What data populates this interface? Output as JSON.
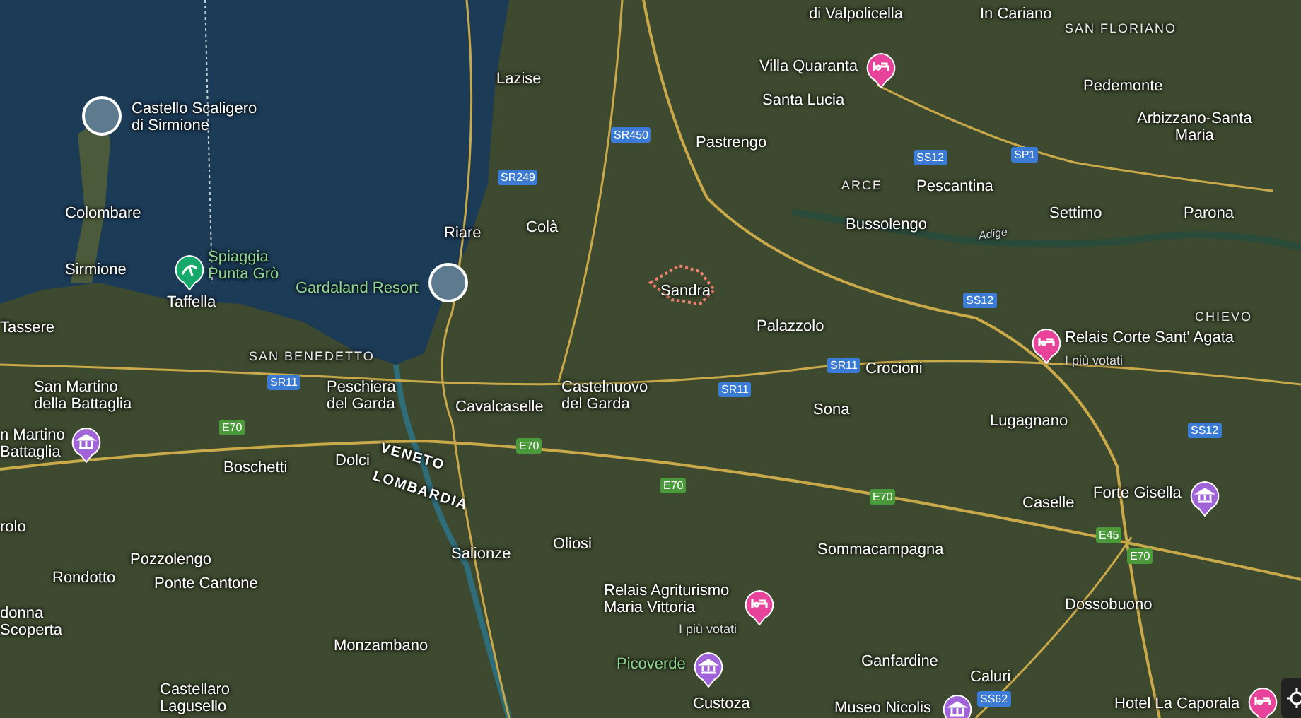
{
  "map": {
    "places": [
      {
        "name": "di Valpolicella",
        "kind": "town"
      },
      {
        "name": "In Cariano",
        "kind": "town"
      },
      {
        "name": "SAN FLORIANO",
        "kind": "district"
      },
      {
        "name": "Villa Quaranta",
        "kind": "town"
      },
      {
        "name": "Santa Lucia",
        "kind": "town"
      },
      {
        "name": "Pedemonte",
        "kind": "town"
      },
      {
        "name": "Arbizzano-Santa\nMaria",
        "kind": "town"
      },
      {
        "name": "Lazise",
        "kind": "town"
      },
      {
        "name": "Castello Scaligero\ndi Sirmione",
        "kind": "town"
      },
      {
        "name": "Pastrengo",
        "kind": "town"
      },
      {
        "name": "ARCE",
        "kind": "district"
      },
      {
        "name": "Pescantina",
        "kind": "town"
      },
      {
        "name": "Colombare",
        "kind": "town"
      },
      {
        "name": "Settimo",
        "kind": "town"
      },
      {
        "name": "Parona",
        "kind": "town"
      },
      {
        "name": "Riare",
        "kind": "town"
      },
      {
        "name": "Colà",
        "kind": "town"
      },
      {
        "name": "Bussolengo",
        "kind": "town"
      },
      {
        "name": "Adige",
        "kind": "river"
      },
      {
        "name": "Sirmione",
        "kind": "town"
      },
      {
        "name": "Spiaggia\nPunta Grò",
        "kind": "poi"
      },
      {
        "name": "Gardaland Resort",
        "kind": "poi"
      },
      {
        "name": "Taffella",
        "kind": "town"
      },
      {
        "name": "Sandra",
        "kind": "town"
      },
      {
        "name": "CHIEVO",
        "kind": "district"
      },
      {
        "name": "Tassere",
        "kind": "town"
      },
      {
        "name": "Palazzolo",
        "kind": "town"
      },
      {
        "name": "Relais Corte Sant' Agata",
        "kind": "town"
      },
      {
        "name": "I più votati",
        "kind": "note"
      },
      {
        "name": "SAN BENEDETTO",
        "kind": "district"
      },
      {
        "name": "Crocioni",
        "kind": "town"
      },
      {
        "name": "San Martino\ndella Battaglia",
        "kind": "town"
      },
      {
        "name": "Peschiera\ndel Garda",
        "kind": "town"
      },
      {
        "name": "Cavalcaselle",
        "kind": "town"
      },
      {
        "name": "Castelnuovo\ndel Garda",
        "kind": "town"
      },
      {
        "name": "Sona",
        "kind": "town"
      },
      {
        "name": "n Martino\nBattaglia",
        "kind": "town"
      },
      {
        "name": "Boschetti",
        "kind": "town"
      },
      {
        "name": "Dolci",
        "kind": "town"
      },
      {
        "name": "VENETO",
        "kind": "region"
      },
      {
        "name": "LOMBARDIA",
        "kind": "region"
      },
      {
        "name": "Lugagnano",
        "kind": "town"
      },
      {
        "name": "Forte Gisella",
        "kind": "town"
      },
      {
        "name": "Caselle",
        "kind": "town"
      },
      {
        "name": "rolo",
        "kind": "town"
      },
      {
        "name": "Salionze",
        "kind": "town"
      },
      {
        "name": "Oliosi",
        "kind": "town"
      },
      {
        "name": "Sommacampagna",
        "kind": "town"
      },
      {
        "name": "Pozzolengo",
        "kind": "town"
      },
      {
        "name": "Rondotto",
        "kind": "town"
      },
      {
        "name": "Ponte Cantone",
        "kind": "town"
      },
      {
        "name": "Relais Agriturismo\nMaria Vittoria",
        "kind": "town"
      },
      {
        "name": "I più votati",
        "kind": "note"
      },
      {
        "name": "donna\nScoperta",
        "kind": "town"
      },
      {
        "name": "Dossobuono",
        "kind": "town"
      },
      {
        "name": "Monzambano",
        "kind": "town"
      },
      {
        "name": "Picoverde",
        "kind": "poi"
      },
      {
        "name": "Ganfardine",
        "kind": "town"
      },
      {
        "name": "Caluri",
        "kind": "town"
      },
      {
        "name": "Castellaro\nLagusello",
        "kind": "town"
      },
      {
        "name": "Custoza",
        "kind": "town"
      },
      {
        "name": "Museo Nicolis",
        "kind": "town"
      },
      {
        "name": "Hotel La Caporala",
        "kind": "town"
      }
    ],
    "pins": [
      {
        "kind": "hotel",
        "color": "#e8439a"
      },
      {
        "kind": "photo",
        "color": "#ffffff"
      },
      {
        "kind": "beach",
        "color": "#17a86b"
      },
      {
        "kind": "photo",
        "color": "#ffffff"
      },
      {
        "kind": "hotel",
        "color": "#e8439a"
      },
      {
        "kind": "museum",
        "color": "#a064d8"
      },
      {
        "kind": "museum",
        "color": "#a064d8"
      },
      {
        "kind": "hotel",
        "color": "#e8439a"
      },
      {
        "kind": "museum",
        "color": "#a064d8"
      },
      {
        "kind": "museum",
        "color": "#a064d8"
      },
      {
        "kind": "hotel",
        "color": "#e8439a"
      }
    ],
    "road_badges": [
      {
        "label": "SR450",
        "kind": "regional"
      },
      {
        "label": "SR249",
        "kind": "regional"
      },
      {
        "label": "SS12",
        "kind": "regional"
      },
      {
        "label": "SP1",
        "kind": "regional"
      },
      {
        "label": "SS12",
        "kind": "regional"
      },
      {
        "label": "SR11",
        "kind": "regional"
      },
      {
        "label": "SR11",
        "kind": "regional"
      },
      {
        "label": "SR11",
        "kind": "regional"
      },
      {
        "label": "E70",
        "kind": "european"
      },
      {
        "label": "E70",
        "kind": "european"
      },
      {
        "label": "E70",
        "kind": "european"
      },
      {
        "label": "E70",
        "kind": "european"
      },
      {
        "label": "SS12",
        "kind": "regional"
      },
      {
        "label": "E45",
        "kind": "european"
      },
      {
        "label": "E70",
        "kind": "european"
      },
      {
        "label": "SS62",
        "kind": "regional"
      }
    ]
  }
}
